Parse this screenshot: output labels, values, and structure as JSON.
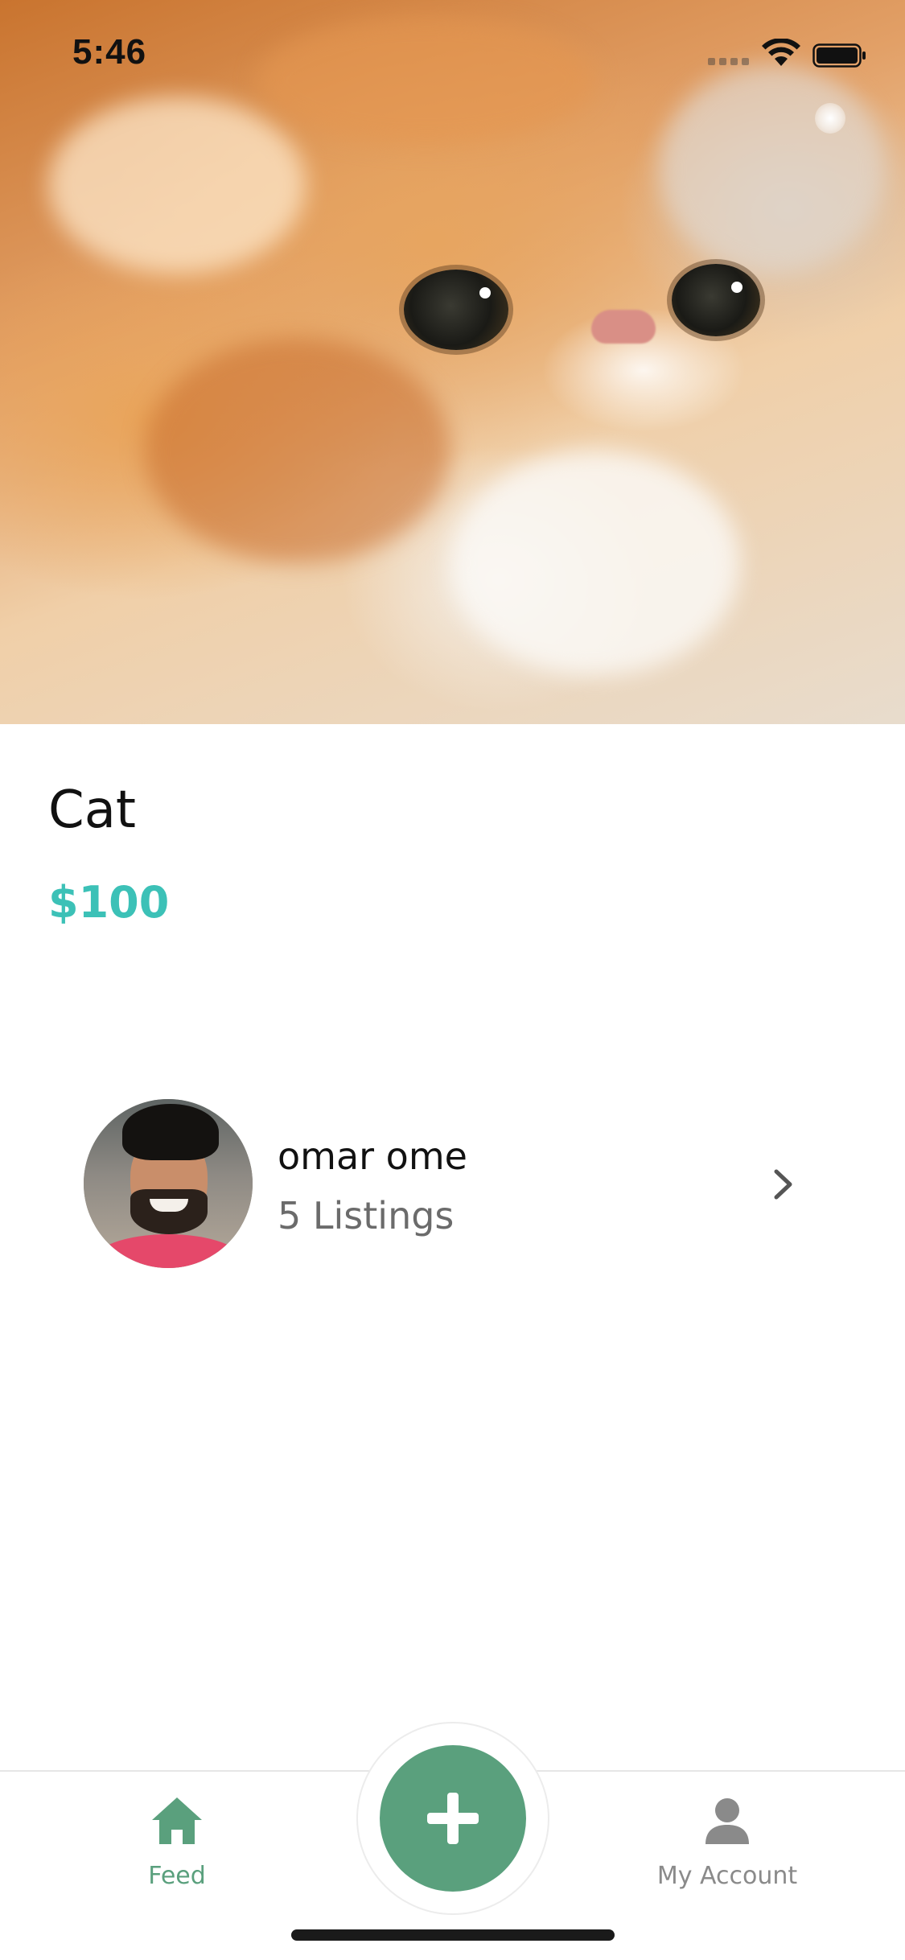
{
  "status_bar": {
    "time": "5:46"
  },
  "listing": {
    "image_subject": "kitten-photo",
    "title": "Cat",
    "price": "$100"
  },
  "seller": {
    "name": "omar ome",
    "listings": "5 Listings"
  },
  "tab_bar": {
    "feed_label": "Feed",
    "account_label": "My Account",
    "add_icon": "plus-icon",
    "feed_icon": "home-icon",
    "account_icon": "person-icon"
  },
  "colors": {
    "accent_green": "#5aa07d",
    "price_teal": "#3cc1b7",
    "inactive_gray": "#8a8a8a"
  }
}
